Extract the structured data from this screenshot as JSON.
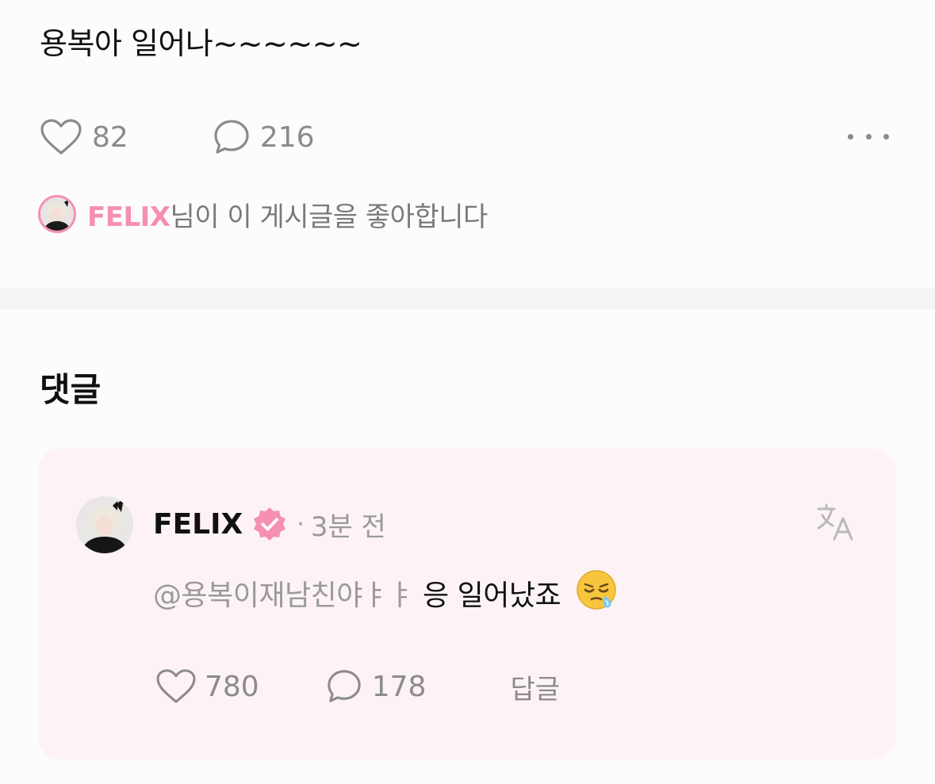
{
  "post": {
    "text": "용복아 일어나~~~~~~",
    "like_count": "82",
    "comment_count": "216",
    "more_icon": "more-horizontal-icon",
    "liked_by": {
      "name": "FELIX",
      "suffix": "님이 이 게시글을 좋아합니다"
    }
  },
  "comments_section": {
    "title": "댓글"
  },
  "comment": {
    "author": "FELIX",
    "verified_icon": "verified-badge-icon",
    "separator": "·",
    "time": "3분 전",
    "mention": "@용복이재남친야ㅑㅑ",
    "text": "응 일어났죠",
    "emoji_icon": "sleepy-face-emoji",
    "like_count": "780",
    "reply_count": "178",
    "reply_label": "답글",
    "translate_icon": "translate-icon"
  },
  "colors": {
    "accent_pink": "#f58fb3",
    "card_bg": "#fdf3f6",
    "muted_text": "#8b8b8b"
  }
}
